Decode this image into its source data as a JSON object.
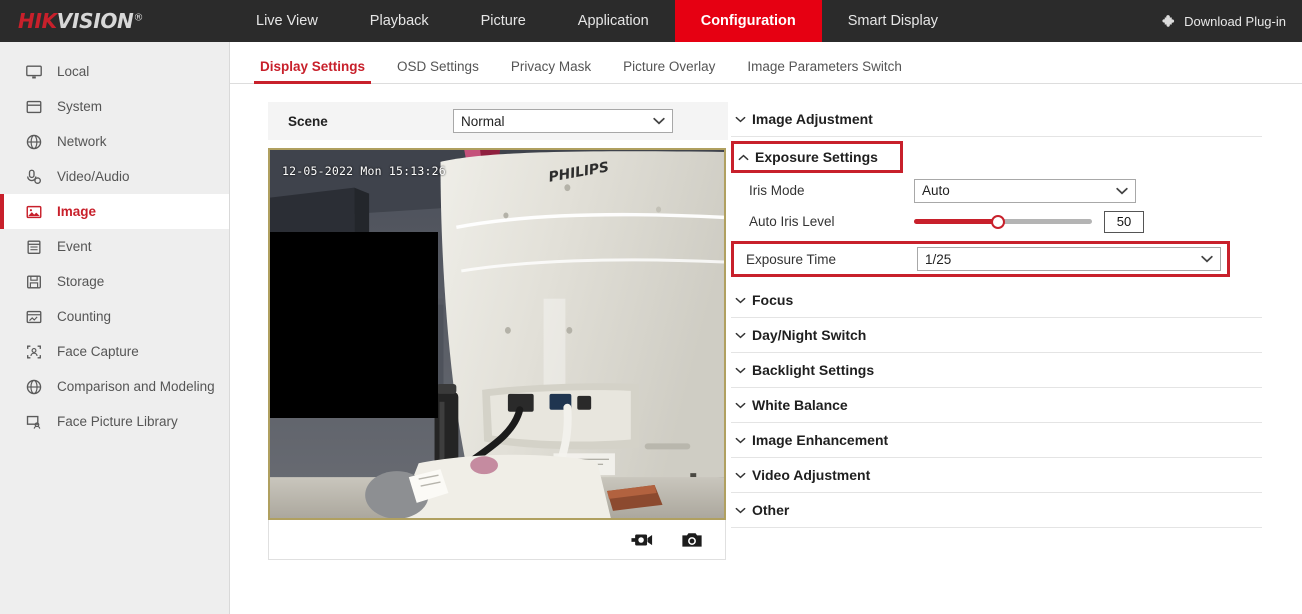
{
  "brand": {
    "logo_hik": "HIK",
    "logo_vision": "VISION",
    "logo_reg": "®"
  },
  "topnav": {
    "items": [
      {
        "label": "Live View",
        "active": false
      },
      {
        "label": "Playback",
        "active": false
      },
      {
        "label": "Picture",
        "active": false
      },
      {
        "label": "Application",
        "active": false
      },
      {
        "label": "Configuration",
        "active": true
      },
      {
        "label": "Smart Display",
        "active": false
      }
    ],
    "plugin_label": "Download Plug-in",
    "plugin_icon": "puzzle-piece-icon",
    "active_color": "#e60012",
    "background": "#2b2b2b"
  },
  "sidebar": {
    "items": [
      {
        "label": "Local",
        "icon": "monitor-icon",
        "active": false
      },
      {
        "label": "System",
        "icon": "window-icon",
        "active": false
      },
      {
        "label": "Network",
        "icon": "globe-icon",
        "active": false
      },
      {
        "label": "Video/Audio",
        "icon": "microphone-icon",
        "active": false
      },
      {
        "label": "Image",
        "icon": "picture-icon",
        "active": true
      },
      {
        "label": "Event",
        "icon": "clipboard-icon",
        "active": false
      },
      {
        "label": "Storage",
        "icon": "floppy-disk-icon",
        "active": false
      },
      {
        "label": "Counting",
        "icon": "counting-icon",
        "active": false
      },
      {
        "label": "Face Capture",
        "icon": "face-capture-icon",
        "active": false
      },
      {
        "label": "Comparison and Modeling",
        "icon": "comparison-icon",
        "active": false
      },
      {
        "label": "Face Picture Library",
        "icon": "face-library-icon",
        "active": false
      }
    ],
    "active_color": "#c8202b"
  },
  "tabs": {
    "items": [
      {
        "label": "Display Settings",
        "active": true
      },
      {
        "label": "OSD Settings",
        "active": false
      },
      {
        "label": "Privacy Mask",
        "active": false
      },
      {
        "label": "Picture Overlay",
        "active": false
      },
      {
        "label": "Image Parameters Switch",
        "active": false
      }
    ]
  },
  "scene": {
    "label": "Scene",
    "value": "Normal"
  },
  "video": {
    "osd_timestamp": "12-05-2022 Mon 15:13:26",
    "monitor_brand_text": "PHILIPS",
    "toolbar": {
      "record_icon": "video-record-icon",
      "snapshot_icon": "camera-snapshot-icon"
    }
  },
  "settings": {
    "sections": [
      {
        "id": "image-adjustment",
        "label": "Image Adjustment",
        "expanded": false,
        "highlighted": false
      },
      {
        "id": "exposure-settings",
        "label": "Exposure Settings",
        "expanded": true,
        "highlighted": true
      },
      {
        "id": "focus",
        "label": "Focus",
        "expanded": false,
        "highlighted": false
      },
      {
        "id": "day-night-switch",
        "label": "Day/Night Switch",
        "expanded": false,
        "highlighted": false
      },
      {
        "id": "backlight-settings",
        "label": "Backlight Settings",
        "expanded": false,
        "highlighted": false
      },
      {
        "id": "white-balance",
        "label": "White Balance",
        "expanded": false,
        "highlighted": false
      },
      {
        "id": "image-enhancement",
        "label": "Image Enhancement",
        "expanded": false,
        "highlighted": false
      },
      {
        "id": "video-adjustment",
        "label": "Video Adjustment",
        "expanded": false,
        "highlighted": false
      },
      {
        "id": "other",
        "label": "Other",
        "expanded": false,
        "highlighted": false
      }
    ],
    "exposure": {
      "iris_mode": {
        "label": "Iris Mode",
        "value": "Auto"
      },
      "auto_iris_level": {
        "label": "Auto Iris Level",
        "value": "50",
        "percent": 47
      },
      "exposure_time": {
        "label": "Exposure Time",
        "value": "1/25",
        "highlighted": true
      }
    },
    "highlight_color": "#c8202b"
  }
}
